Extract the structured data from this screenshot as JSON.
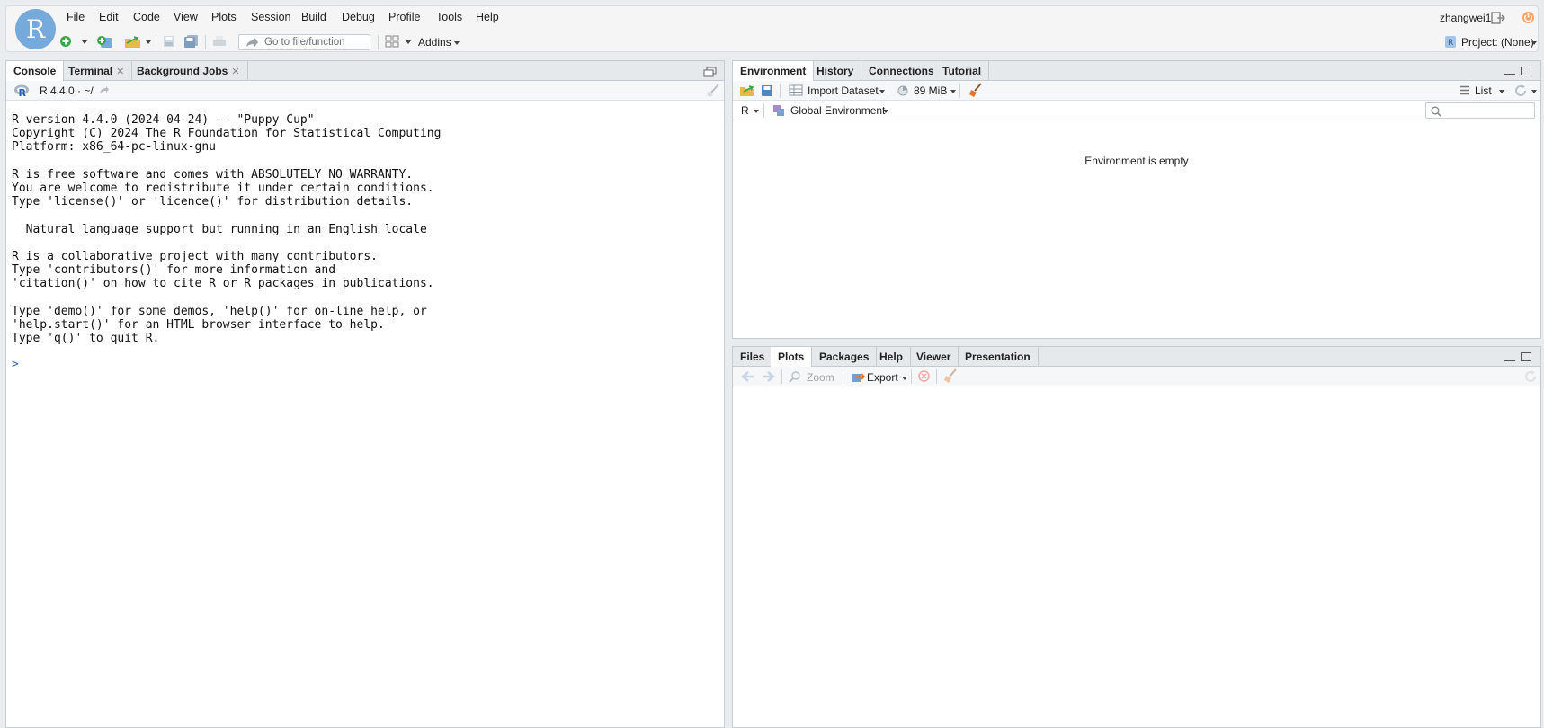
{
  "app": {
    "logo_letter": "R",
    "menu": [
      "File",
      "Edit",
      "Code",
      "View",
      "Plots",
      "Session",
      "Build",
      "Debug",
      "Profile",
      "Tools",
      "Help"
    ],
    "user": "zhangwei1",
    "goto_placeholder": "Go to file/function",
    "addins_label": "Addins",
    "project_label": "Project: (None)"
  },
  "console_pane": {
    "tabs": [
      {
        "label": "Console",
        "active": true,
        "closable": false
      },
      {
        "label": "Terminal",
        "active": false,
        "closable": true
      },
      {
        "label": "Background Jobs",
        "active": false,
        "closable": true
      }
    ],
    "path_label": "R 4.4.0 · ~/",
    "output_lines": [
      "R version 4.4.0 (2024-04-24) -- \"Puppy Cup\"",
      "Copyright (C) 2024 The R Foundation for Statistical Computing",
      "Platform: x86_64-pc-linux-gnu",
      "",
      "R is free software and comes with ABSOLUTELY NO WARRANTY.",
      "You are welcome to redistribute it under certain conditions.",
      "Type 'license()' or 'licence()' for distribution details.",
      "",
      "  Natural language support but running in an English locale",
      "",
      "R is a collaborative project with many contributors.",
      "Type 'contributors()' for more information and",
      "'citation()' on how to cite R or R packages in publications.",
      "",
      "Type 'demo()' for some demos, 'help()' for on-line help, or",
      "'help.start()' for an HTML browser interface to help.",
      "Type 'q()' to quit R."
    ],
    "prompt": ">"
  },
  "env_pane": {
    "tabs": [
      "Environment",
      "History",
      "Connections",
      "Tutorial"
    ],
    "import_label": "Import Dataset",
    "memory_label": "89 MiB",
    "list_label": "List",
    "lang_label": "R",
    "scope_label": "Global Environment",
    "empty_message": "Environment is empty"
  },
  "files_pane": {
    "tabs": [
      "Files",
      "Plots",
      "Packages",
      "Help",
      "Viewer",
      "Presentation"
    ],
    "active_tab": "Plots",
    "zoom_label": "Zoom",
    "export_label": "Export"
  },
  "colors": {
    "r_blue": "#75aadb",
    "accent_orange": "#e8742a",
    "folder_yellow": "#e7b84a",
    "green_add": "#3aa64a"
  },
  "icons": [
    "new-file-icon",
    "new-project-icon",
    "open-folder-icon",
    "save-icon",
    "save-all-icon",
    "print-icon",
    "goto-arrow-icon",
    "grid-icon",
    "signout-icon",
    "power-icon",
    "project-icon",
    "broom-icon",
    "search-icon",
    "refresh-icon",
    "back-arrow-icon",
    "forward-arrow-icon",
    "zoom-icon",
    "export-icon",
    "delete-icon",
    "r-logo-icon",
    "list-icon",
    "memory-pie-icon",
    "database-icon"
  ]
}
